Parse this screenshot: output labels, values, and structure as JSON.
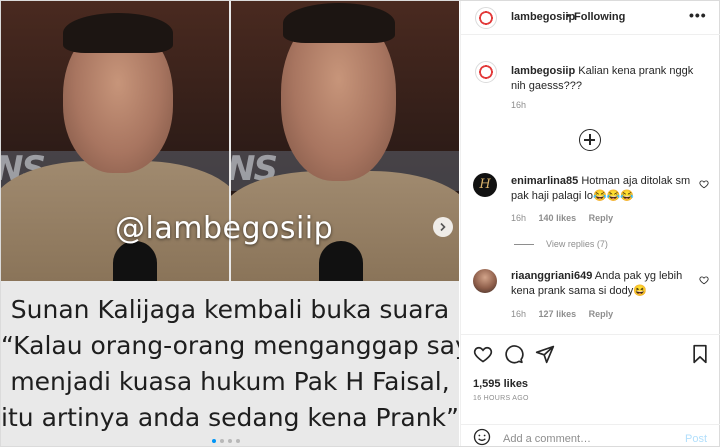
{
  "media": {
    "watermark": "@lambegosiip",
    "background_text": "NS",
    "caption_lines": [
      "Sunan Kalijaga kembali buka suara",
      "“Kalau orang-orang menganggap saya",
      "menjadi kuasa hukum Pak H Faisal,",
      "itu artinya anda sedang kena Prank”"
    ],
    "carousel_dots": 4,
    "active_dot": 0
  },
  "header": {
    "username": "lambegosiip",
    "separator": "•",
    "follow_status": "Following",
    "more_icon": "more-horizontal-icon"
  },
  "caption": {
    "username": "lambegosiip",
    "text": "Kalian kena prank nggk nih gaesss???",
    "time": "16h"
  },
  "comments": [
    {
      "username": "enimarlina85",
      "text": "Hotman aja ditolak sm pak haji palagi lo😂😂😂",
      "time": "16h",
      "likes": "140 likes",
      "reply": "Reply",
      "view_replies": "View replies (7)"
    },
    {
      "username": "riaanggriani649",
      "text": "Anda pak yg lebih kena prank sama si dody😆",
      "time": "16h",
      "likes": "127 likes",
      "reply": "Reply"
    }
  ],
  "post": {
    "likes": "1,595 likes",
    "time_ago": "16 HOURS AGO",
    "comment_placeholder": "Add a comment…",
    "post_button": "Post"
  },
  "colors": {
    "accent": "#0095f6",
    "post_disabled": "#b2dffc",
    "muted": "#8e8e8e"
  }
}
